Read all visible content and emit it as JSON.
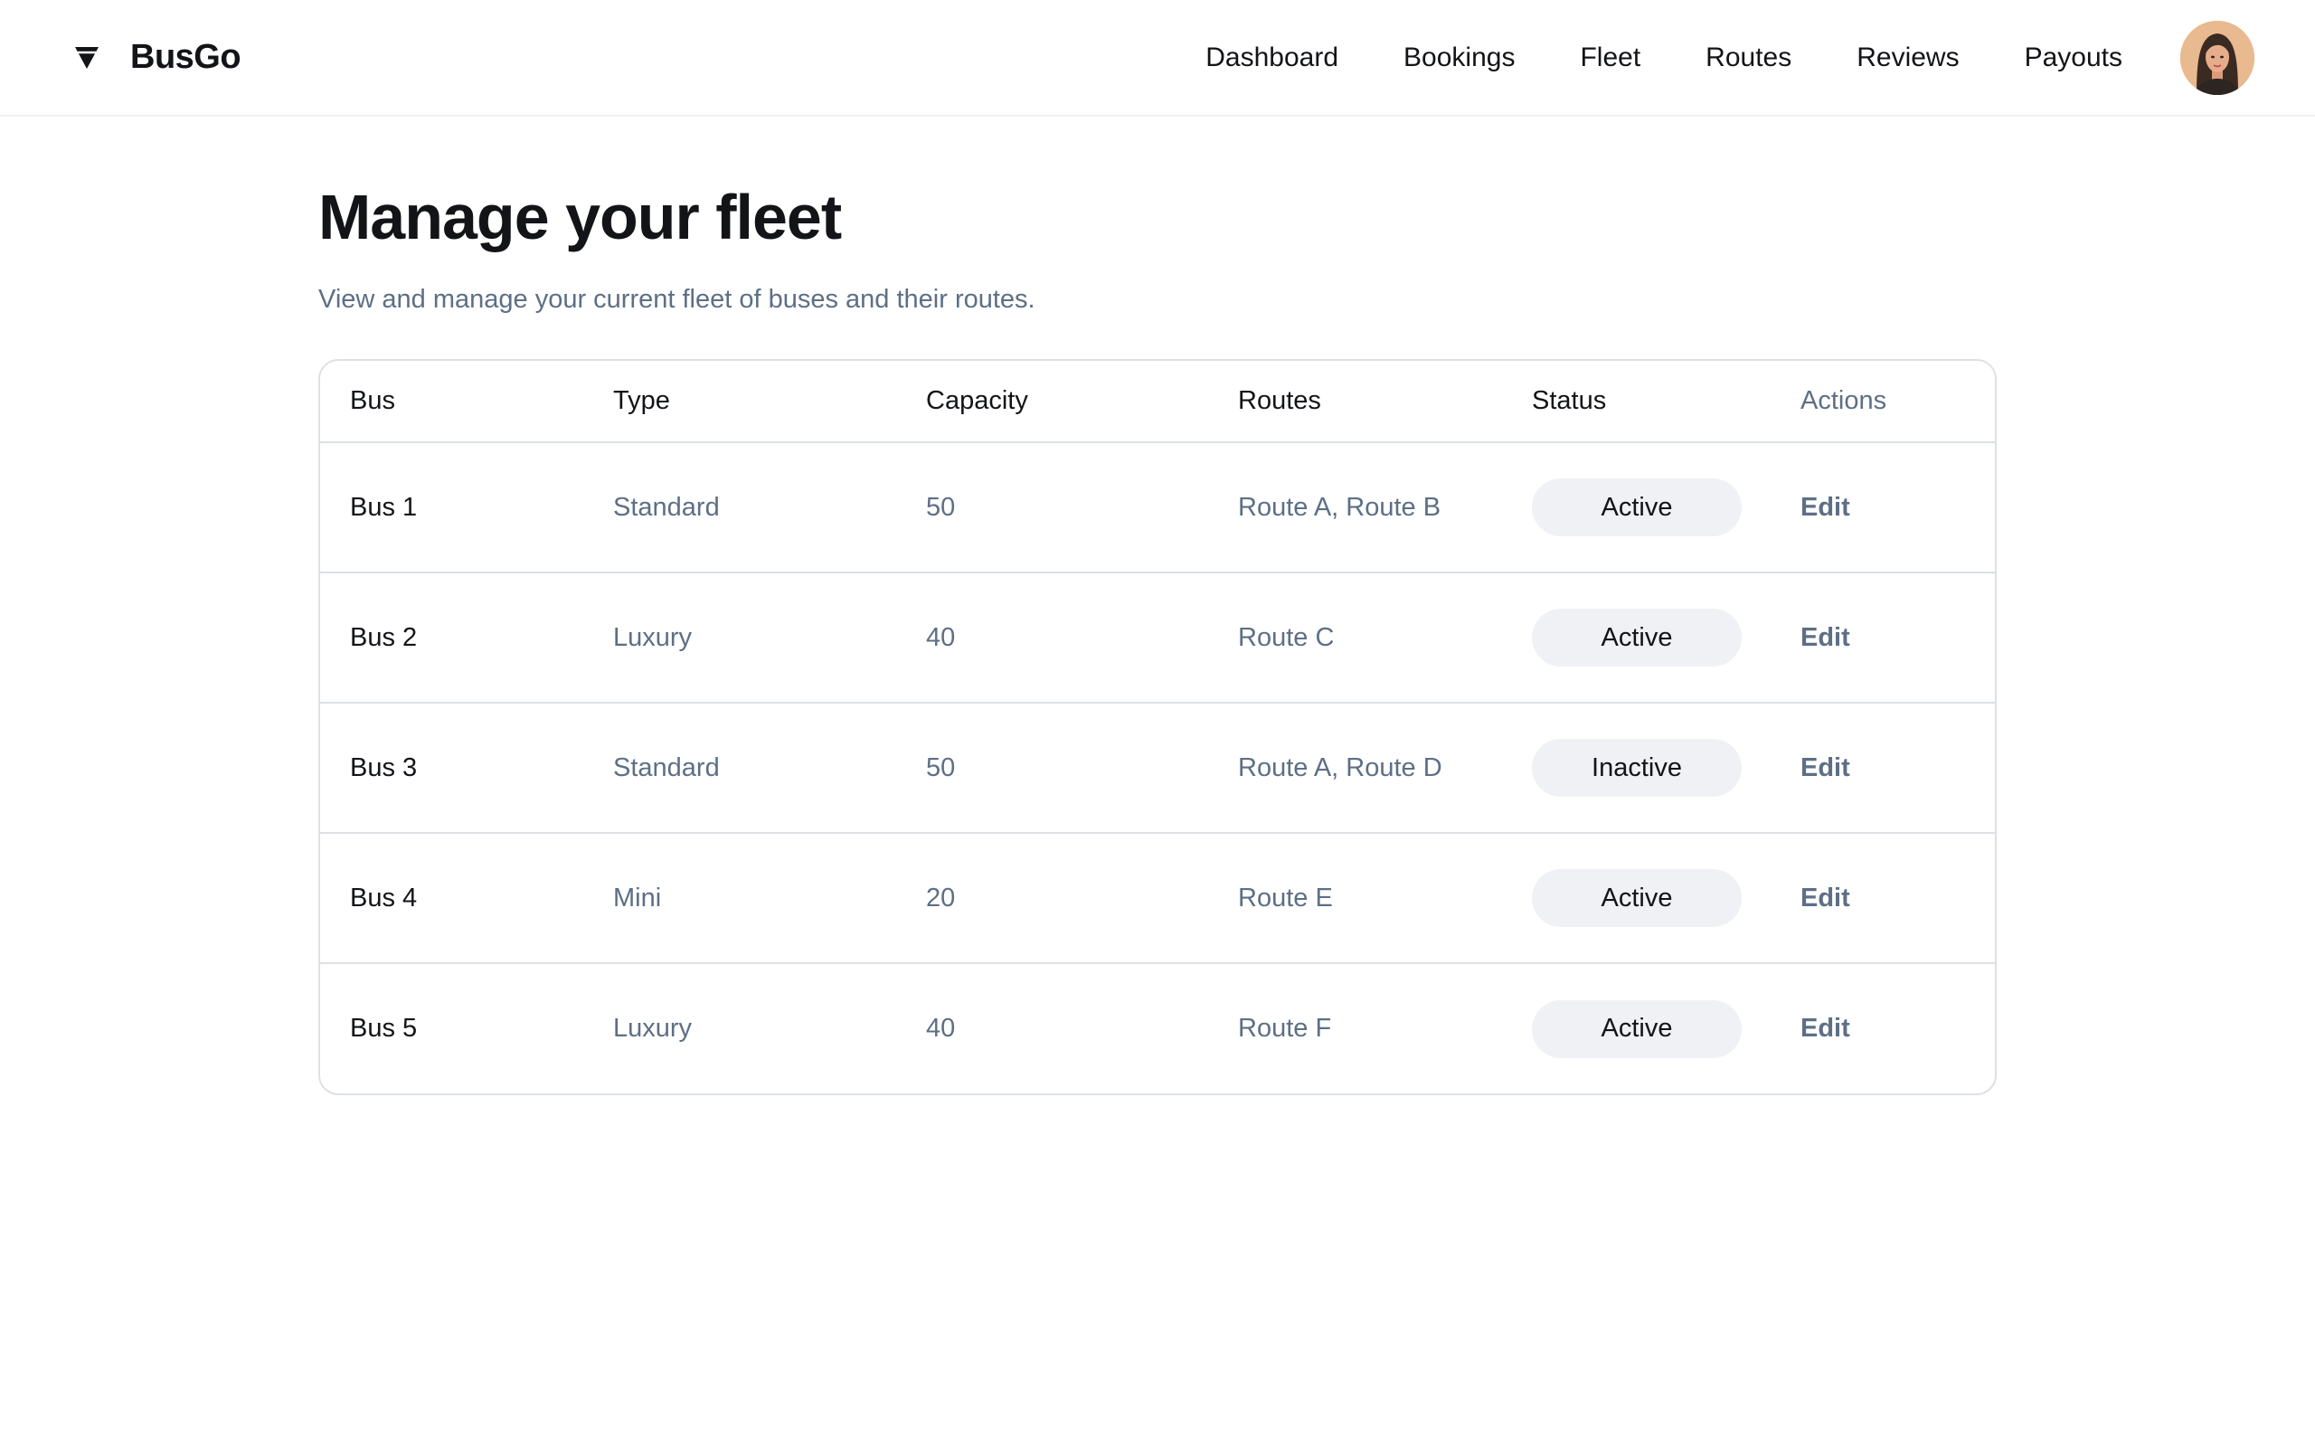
{
  "brand": {
    "name": "BusGo",
    "icon": "busgo-logo-icon"
  },
  "nav": {
    "items": [
      "Dashboard",
      "Bookings",
      "Fleet",
      "Routes",
      "Reviews",
      "Payouts"
    ],
    "avatar": "user-avatar"
  },
  "page": {
    "title": "Manage your fleet",
    "subtitle": "View and manage your current fleet of buses and their routes."
  },
  "table": {
    "headers": [
      "Bus",
      "Type",
      "Capacity",
      "Routes",
      "Status",
      "Actions"
    ],
    "rows": [
      {
        "bus": "Bus 1",
        "type": "Standard",
        "capacity": "50",
        "routes": "Route A, Route B",
        "status": "Active",
        "action": "Edit"
      },
      {
        "bus": "Bus 2",
        "type": "Luxury",
        "capacity": "40",
        "routes": "Route C",
        "status": "Active",
        "action": "Edit"
      },
      {
        "bus": "Bus 3",
        "type": "Standard",
        "capacity": "50",
        "routes": "Route A, Route D",
        "status": "Inactive",
        "action": "Edit"
      },
      {
        "bus": "Bus 4",
        "type": "Mini",
        "capacity": "20",
        "routes": "Route E",
        "status": "Active",
        "action": "Edit"
      },
      {
        "bus": "Bus 5",
        "type": "Luxury",
        "capacity": "40",
        "routes": "Route F",
        "status": "Active",
        "action": "Edit"
      }
    ]
  },
  "colors": {
    "text_primary": "#121417",
    "text_secondary": "#5d6f85",
    "border": "#dde0e5",
    "pill_bg": "#eff1f4"
  }
}
